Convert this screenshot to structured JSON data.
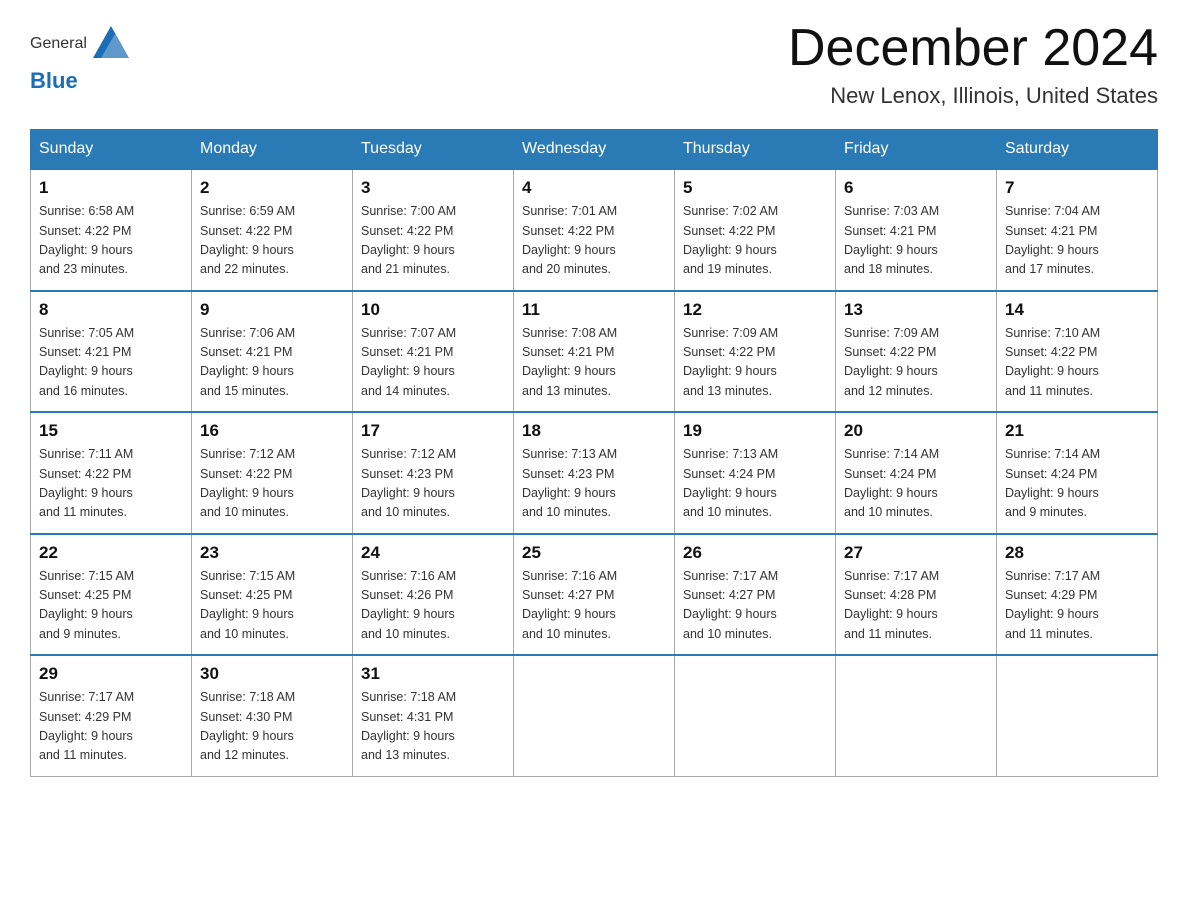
{
  "header": {
    "logo_general": "General",
    "logo_blue": "Blue",
    "month_title": "December 2024",
    "location": "New Lenox, Illinois, United States"
  },
  "weekdays": [
    "Sunday",
    "Monday",
    "Tuesday",
    "Wednesday",
    "Thursday",
    "Friday",
    "Saturday"
  ],
  "weeks": [
    [
      {
        "day": "1",
        "sunrise": "6:58 AM",
        "sunset": "4:22 PM",
        "daylight": "9 hours and 23 minutes."
      },
      {
        "day": "2",
        "sunrise": "6:59 AM",
        "sunset": "4:22 PM",
        "daylight": "9 hours and 22 minutes."
      },
      {
        "day": "3",
        "sunrise": "7:00 AM",
        "sunset": "4:22 PM",
        "daylight": "9 hours and 21 minutes."
      },
      {
        "day": "4",
        "sunrise": "7:01 AM",
        "sunset": "4:22 PM",
        "daylight": "9 hours and 20 minutes."
      },
      {
        "day": "5",
        "sunrise": "7:02 AM",
        "sunset": "4:22 PM",
        "daylight": "9 hours and 19 minutes."
      },
      {
        "day": "6",
        "sunrise": "7:03 AM",
        "sunset": "4:21 PM",
        "daylight": "9 hours and 18 minutes."
      },
      {
        "day": "7",
        "sunrise": "7:04 AM",
        "sunset": "4:21 PM",
        "daylight": "9 hours and 17 minutes."
      }
    ],
    [
      {
        "day": "8",
        "sunrise": "7:05 AM",
        "sunset": "4:21 PM",
        "daylight": "9 hours and 16 minutes."
      },
      {
        "day": "9",
        "sunrise": "7:06 AM",
        "sunset": "4:21 PM",
        "daylight": "9 hours and 15 minutes."
      },
      {
        "day": "10",
        "sunrise": "7:07 AM",
        "sunset": "4:21 PM",
        "daylight": "9 hours and 14 minutes."
      },
      {
        "day": "11",
        "sunrise": "7:08 AM",
        "sunset": "4:21 PM",
        "daylight": "9 hours and 13 minutes."
      },
      {
        "day": "12",
        "sunrise": "7:09 AM",
        "sunset": "4:22 PM",
        "daylight": "9 hours and 13 minutes."
      },
      {
        "day": "13",
        "sunrise": "7:09 AM",
        "sunset": "4:22 PM",
        "daylight": "9 hours and 12 minutes."
      },
      {
        "day": "14",
        "sunrise": "7:10 AM",
        "sunset": "4:22 PM",
        "daylight": "9 hours and 11 minutes."
      }
    ],
    [
      {
        "day": "15",
        "sunrise": "7:11 AM",
        "sunset": "4:22 PM",
        "daylight": "9 hours and 11 minutes."
      },
      {
        "day": "16",
        "sunrise": "7:12 AM",
        "sunset": "4:22 PM",
        "daylight": "9 hours and 10 minutes."
      },
      {
        "day": "17",
        "sunrise": "7:12 AM",
        "sunset": "4:23 PM",
        "daylight": "9 hours and 10 minutes."
      },
      {
        "day": "18",
        "sunrise": "7:13 AM",
        "sunset": "4:23 PM",
        "daylight": "9 hours and 10 minutes."
      },
      {
        "day": "19",
        "sunrise": "7:13 AM",
        "sunset": "4:24 PM",
        "daylight": "9 hours and 10 minutes."
      },
      {
        "day": "20",
        "sunrise": "7:14 AM",
        "sunset": "4:24 PM",
        "daylight": "9 hours and 10 minutes."
      },
      {
        "day": "21",
        "sunrise": "7:14 AM",
        "sunset": "4:24 PM",
        "daylight": "9 hours and 9 minutes."
      }
    ],
    [
      {
        "day": "22",
        "sunrise": "7:15 AM",
        "sunset": "4:25 PM",
        "daylight": "9 hours and 9 minutes."
      },
      {
        "day": "23",
        "sunrise": "7:15 AM",
        "sunset": "4:25 PM",
        "daylight": "9 hours and 10 minutes."
      },
      {
        "day": "24",
        "sunrise": "7:16 AM",
        "sunset": "4:26 PM",
        "daylight": "9 hours and 10 minutes."
      },
      {
        "day": "25",
        "sunrise": "7:16 AM",
        "sunset": "4:27 PM",
        "daylight": "9 hours and 10 minutes."
      },
      {
        "day": "26",
        "sunrise": "7:17 AM",
        "sunset": "4:27 PM",
        "daylight": "9 hours and 10 minutes."
      },
      {
        "day": "27",
        "sunrise": "7:17 AM",
        "sunset": "4:28 PM",
        "daylight": "9 hours and 11 minutes."
      },
      {
        "day": "28",
        "sunrise": "7:17 AM",
        "sunset": "4:29 PM",
        "daylight": "9 hours and 11 minutes."
      }
    ],
    [
      {
        "day": "29",
        "sunrise": "7:17 AM",
        "sunset": "4:29 PM",
        "daylight": "9 hours and 11 minutes."
      },
      {
        "day": "30",
        "sunrise": "7:18 AM",
        "sunset": "4:30 PM",
        "daylight": "9 hours and 12 minutes."
      },
      {
        "day": "31",
        "sunrise": "7:18 AM",
        "sunset": "4:31 PM",
        "daylight": "9 hours and 13 minutes."
      },
      null,
      null,
      null,
      null
    ]
  ],
  "labels": {
    "sunrise": "Sunrise:",
    "sunset": "Sunset:",
    "daylight": "Daylight:"
  }
}
